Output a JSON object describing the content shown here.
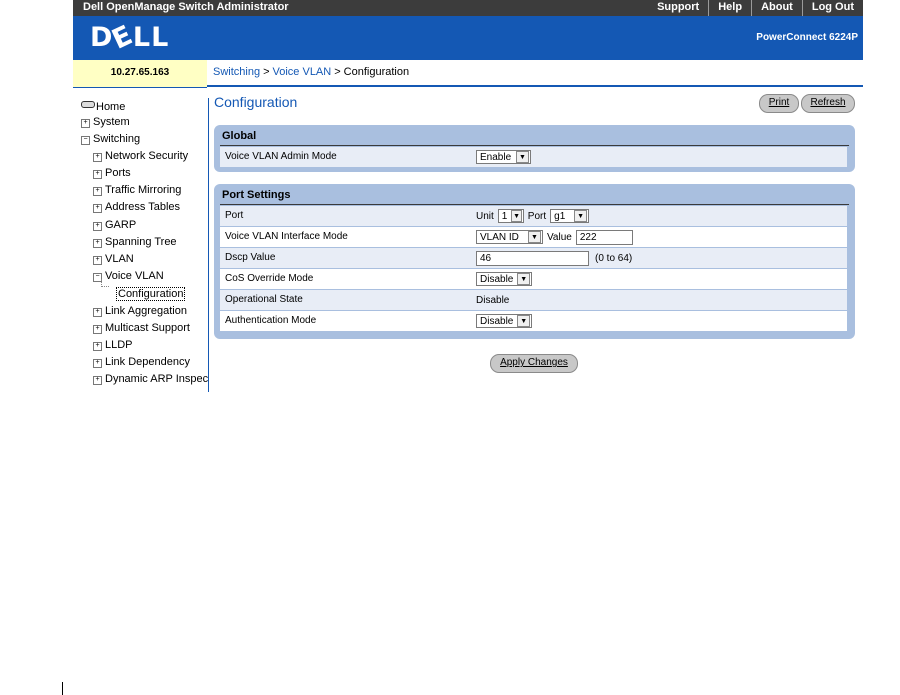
{
  "app": {
    "title": "Dell OpenManage Switch Administrator",
    "links": [
      "Support",
      "Help",
      "About",
      "Log Out"
    ],
    "logo": "DELL",
    "model": "PowerConnect 6224P",
    "ip": "10.27.65.163"
  },
  "breadcrumb": {
    "items": [
      "Switching",
      "Voice VLAN",
      "Configuration"
    ],
    "separator": ">"
  },
  "sidebar": {
    "items": [
      {
        "label": "Home"
      },
      {
        "label": "System"
      },
      {
        "label": "Switching"
      },
      {
        "label": "Network Security"
      },
      {
        "label": "Ports"
      },
      {
        "label": "Traffic Mirroring"
      },
      {
        "label": "Address Tables"
      },
      {
        "label": "GARP"
      },
      {
        "label": "Spanning Tree"
      },
      {
        "label": "VLAN"
      },
      {
        "label": "Voice VLAN"
      },
      {
        "label": "Configuration"
      },
      {
        "label": "Link Aggregation"
      },
      {
        "label": "Multicast Support"
      },
      {
        "label": "LLDP"
      },
      {
        "label": "Link Dependency"
      },
      {
        "label": "Dynamic ARP Inspecti"
      }
    ]
  },
  "page": {
    "title": "Configuration",
    "print_label": "Print",
    "refresh_label": "Refresh",
    "apply_label": "Apply Changes"
  },
  "global": {
    "heading": "Global",
    "admin_mode_label": "Voice VLAN Admin Mode",
    "admin_mode_value": "Enable"
  },
  "port_settings": {
    "heading": "Port Settings",
    "port_label": "Port",
    "unit_label": "Unit",
    "unit_value": "1",
    "port_sub_label": "Port",
    "port_value": "g1",
    "interface_mode_label": "Voice VLAN Interface Mode",
    "interface_mode_value": "VLAN ID",
    "value_label": "Value",
    "value_value": "222",
    "dscp_label": "Dscp Value",
    "dscp_value": "46",
    "dscp_range": "(0 to 64)",
    "cos_label": "CoS Override Mode",
    "cos_value": "Disable",
    "operational_label": "Operational State",
    "operational_value": "Disable",
    "auth_label": "Authentication Mode",
    "auth_value": "Disable"
  },
  "icons": {
    "expand": "plus-box-icon",
    "collapse": "minus-box-icon",
    "dropdown": "chevron-down-icon",
    "home": "home-icon"
  },
  "colors": {
    "topbar": "#3c3c3c",
    "brand": "#1458b4",
    "ip_box": "#ffffc4",
    "panel": "#a9bfdf",
    "row_light": "#e8edf6"
  }
}
